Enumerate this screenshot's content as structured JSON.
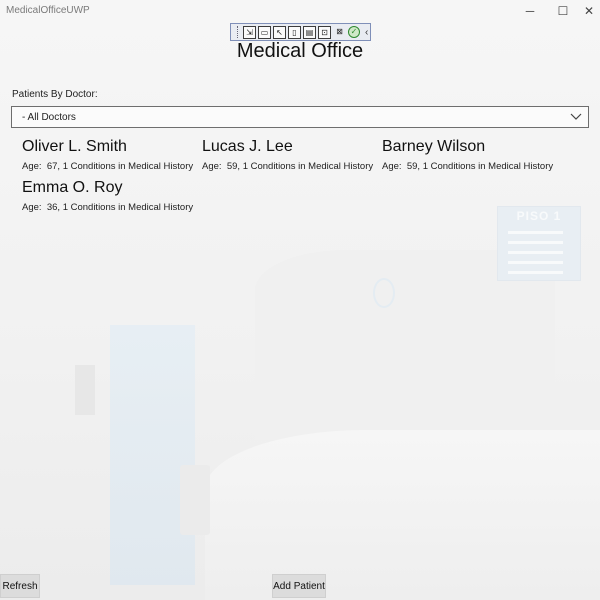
{
  "window": {
    "title": "MedicalOfficeUWP",
    "controls": {
      "minimize": "─",
      "maximize": "☐",
      "close": "✕"
    }
  },
  "debug_toolbar": {
    "buttons": [
      "select-element-icon",
      "video-icon",
      "pointer-icon",
      "layout-icon",
      "adorner-icon",
      "track-focus-icon",
      "binding-icon",
      "ok-icon",
      "collapse-icon"
    ]
  },
  "page": {
    "title": "Medical Office"
  },
  "filter": {
    "label": "Patients By Doctor:",
    "selected": "- All Doctors"
  },
  "patients": [
    {
      "name": "Oliver L. Smith",
      "age_label": "Age:",
      "age": "67,",
      "conditions": "1 Conditions in Medical History"
    },
    {
      "name": "Lucas J. Lee",
      "age_label": "Age:",
      "age": "59,",
      "conditions": "1 Conditions in Medical History"
    },
    {
      "name": "Barney Wilson",
      "age_label": "Age:",
      "age": "59,",
      "conditions": "1 Conditions in Medical History"
    },
    {
      "name": "Emma O. Roy",
      "age_label": "Age:",
      "age": "36,",
      "conditions": "1 Conditions in Medical History"
    }
  ],
  "actions": {
    "refresh": "Refresh",
    "add_patient": "Add Patient"
  },
  "background": {
    "sign_text": "PISO 1"
  }
}
